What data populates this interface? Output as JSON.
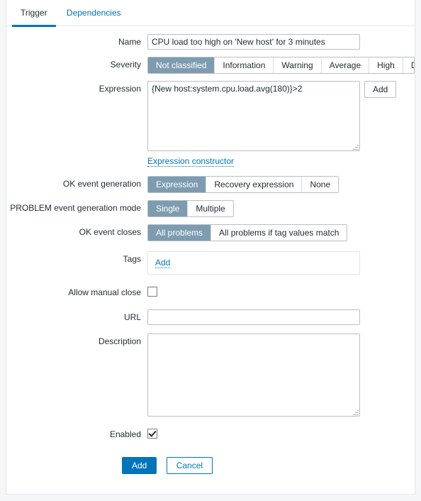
{
  "tabs": [
    {
      "label": "Trigger",
      "active": true
    },
    {
      "label": "Dependencies",
      "active": false
    }
  ],
  "form": {
    "name": {
      "label": "Name",
      "value": "CPU load too high on 'New host' for 3 minutes",
      "placeholder": ""
    },
    "severity": {
      "label": "Severity",
      "options": [
        "Not classified",
        "Information",
        "Warning",
        "Average",
        "High",
        "Disaster"
      ],
      "selected": "Not classified"
    },
    "expression": {
      "label": "Expression",
      "value": "{New host:system.cpu.load.avg(180)}>2",
      "add_button": "Add",
      "constructor_link": "Expression constructor"
    },
    "ok_event_generation": {
      "label": "OK event generation",
      "options": [
        "Expression",
        "Recovery expression",
        "None"
      ],
      "selected": "Expression"
    },
    "problem_event_generation_mode": {
      "label": "PROBLEM event generation mode",
      "options": [
        "Single",
        "Multiple"
      ],
      "selected": "Single"
    },
    "ok_event_closes": {
      "label": "OK event closes",
      "options": [
        "All problems",
        "All problems if tag values match"
      ],
      "selected": "All problems"
    },
    "tags": {
      "label": "Tags",
      "add_link": "Add"
    },
    "allow_manual_close": {
      "label": "Allow manual close",
      "checked": false
    },
    "url": {
      "label": "URL",
      "value": "",
      "placeholder": ""
    },
    "description": {
      "label": "Description",
      "value": "",
      "placeholder": ""
    },
    "enabled": {
      "label": "Enabled",
      "checked": true
    }
  },
  "footer": {
    "submit_label": "Add",
    "cancel_label": "Cancel"
  },
  "colors": {
    "accent": "#0275b8",
    "toggle_selected": "#7e9cb0",
    "text": "#1f2c33",
    "border": "#b9bfc4",
    "page_bg": "#f4f6f8"
  }
}
